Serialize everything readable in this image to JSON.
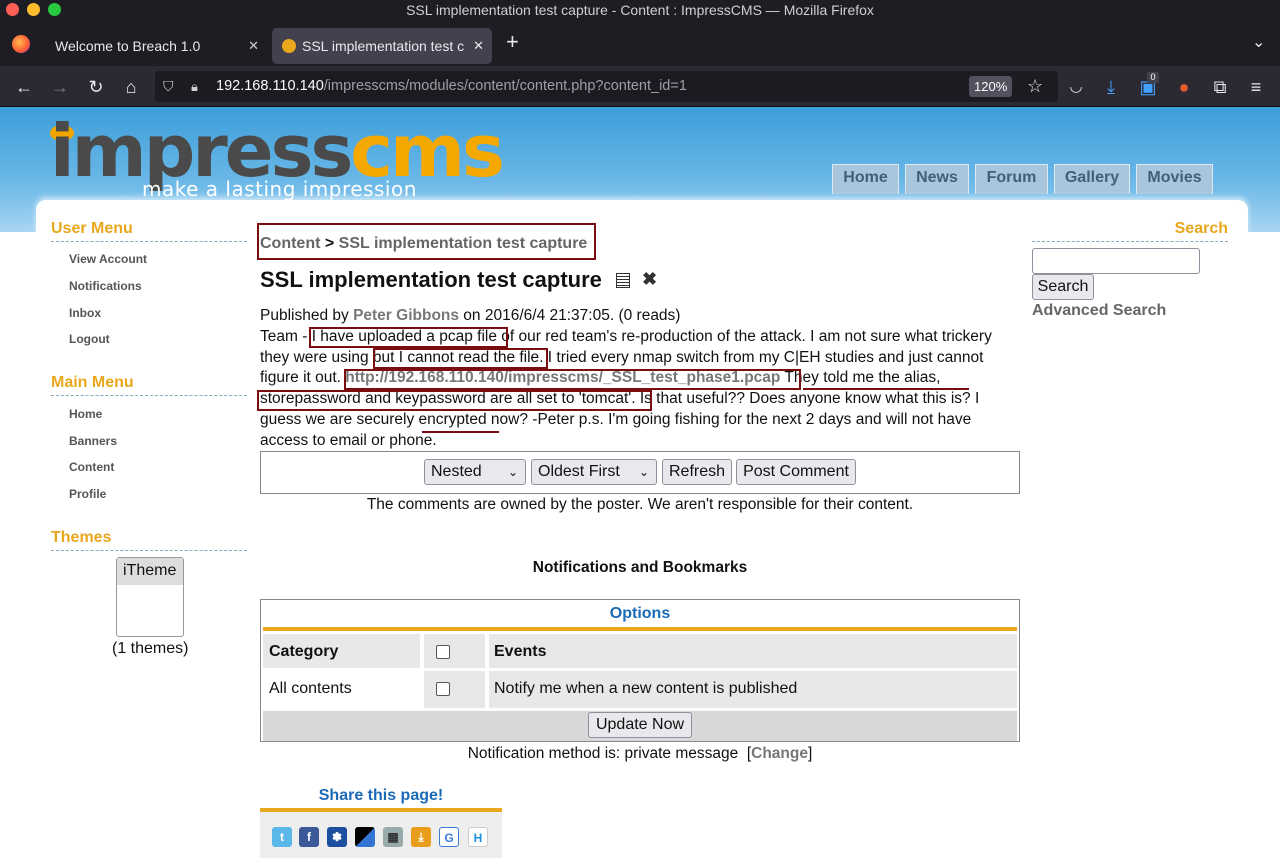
{
  "window": {
    "title": "SSL implementation test capture - Content : ImpressCMS — Mozilla Firefox"
  },
  "tabs": [
    {
      "label": "Welcome to Breach 1.0"
    },
    {
      "label": "SSL implementation test c"
    }
  ],
  "url": {
    "host": "192.168.110.140",
    "path": "/impresscms/modules/content/content.php?content_id=1",
    "zoom": "120%"
  },
  "toolbar": {
    "badge_count": "0"
  },
  "site": {
    "logo_main_a": "impress",
    "logo_main_b": "cms",
    "logo_tagline": "make a lasting impression",
    "nav": [
      "Home",
      "News",
      "Forum",
      "Gallery",
      "Movies"
    ]
  },
  "user_menu": {
    "title": "User Menu",
    "items": [
      "View Account",
      "Notifications",
      "Inbox",
      "Logout"
    ]
  },
  "main_menu": {
    "title": "Main Menu",
    "items": [
      "Home",
      "Banners",
      "Content",
      "Profile"
    ]
  },
  "themes": {
    "title": "Themes",
    "option": "iTheme",
    "count": "(1 themes)"
  },
  "search": {
    "title": "Search",
    "value": "",
    "button": "Search",
    "advanced": "Advanced Search"
  },
  "breadcrumb": {
    "root": "Content",
    "sep": " > ",
    "current": "SSL implementation test capture"
  },
  "article": {
    "title": "SSL implementation test capture",
    "published_prefix": "Published by ",
    "author": "Peter Gibbons",
    "published_suffix": " on 2016/6/4 21:37:05. (0 reads)",
    "t1": "Team - ",
    "t2": "I have uploaded a pcap file",
    "t3": " of our red team's re-production of the attack. I am not sure what trickery they were using ",
    "t4": "but I cannot read the file",
    "t5": ". I tried every nmap switch from my C|EH studies and just cannot figure it out. ",
    "link": "http://192.168.110.140/impresscms/_SSL_test_phase1.pcap",
    "t6": " They told me the alias, ",
    "t7": "storepassword and keypassword are all set to 'tomcat'.",
    "t8": " Is that useful?? Does anyone know what this is? I guess we are securely ",
    "t9": "encrypted",
    "t10": " now? -Peter p.s. I'm going fishing for the next 2 days and will not have access to email or phone."
  },
  "comments": {
    "mode": "Nested",
    "order": "Oldest First",
    "refresh": "Refresh",
    "post": "Post Comment",
    "disclaimer": "The comments are owned by the poster. We aren't responsible for their content."
  },
  "notifications": {
    "heading": "Notifications and Bookmarks",
    "options": "Options",
    "col_category": "Category",
    "col_events": "Events",
    "row_category": "All contents",
    "row_event": "Notify me when a new content is published",
    "update": "Update Now",
    "method_prefix": "Notification method is: private message  [",
    "method_link": "Change",
    "method_suffix": "]"
  },
  "share": {
    "title": "Share this page!"
  }
}
